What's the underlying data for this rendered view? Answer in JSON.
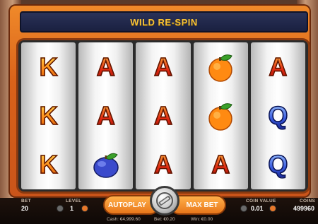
{
  "banner": {
    "title": "WILD RE-SPIN"
  },
  "reels": [
    [
      {
        "letter": "K",
        "style": "orange",
        "icon": "k-symbol-icon"
      },
      {
        "letter": "K",
        "style": "orange",
        "icon": "k-symbol-icon"
      },
      {
        "letter": "K",
        "style": "orange",
        "icon": "k-symbol-icon"
      }
    ],
    [
      {
        "letter": "A",
        "style": "red",
        "icon": "a-symbol-icon"
      },
      {
        "letter": "A",
        "style": "red",
        "icon": "a-symbol-icon"
      },
      {
        "fruit": "plum",
        "icon": "plum-icon"
      }
    ],
    [
      {
        "letter": "A",
        "style": "red",
        "icon": "a-symbol-icon"
      },
      {
        "letter": "A",
        "style": "red",
        "icon": "a-symbol-icon"
      },
      {
        "letter": "A",
        "style": "red",
        "icon": "a-symbol-icon"
      }
    ],
    [
      {
        "fruit": "orange",
        "icon": "orange-fruit-icon"
      },
      {
        "fruit": "orange",
        "icon": "orange-fruit-icon"
      },
      {
        "letter": "A",
        "style": "red",
        "icon": "a-symbol-icon"
      }
    ],
    [
      {
        "letter": "A",
        "style": "red",
        "icon": "a-symbol-icon"
      },
      {
        "letter": "Q",
        "style": "blue",
        "icon": "q-symbol-icon"
      },
      {
        "letter": "Q",
        "style": "blue",
        "icon": "q-symbol-icon"
      }
    ]
  ],
  "controls": {
    "bet_label": "BET",
    "bet_value": "20",
    "level_label": "LEVEL",
    "level_value": "1",
    "autoplay_label": "AUTOPLAY",
    "maxbet_label": "MAX BET",
    "coin_value_label": "COIN VALUE",
    "coin_value": "0.01",
    "coins_label": "COINS",
    "coins_value": "499960"
  },
  "footer": {
    "cash": "Cash: €4,999.60",
    "bet": "Bet: €0.20",
    "win": "Win: €0.00"
  },
  "colors": {
    "accent": "#f08a2a",
    "banner_text": "#f6c23a",
    "banner_bg": "#1a2040"
  }
}
